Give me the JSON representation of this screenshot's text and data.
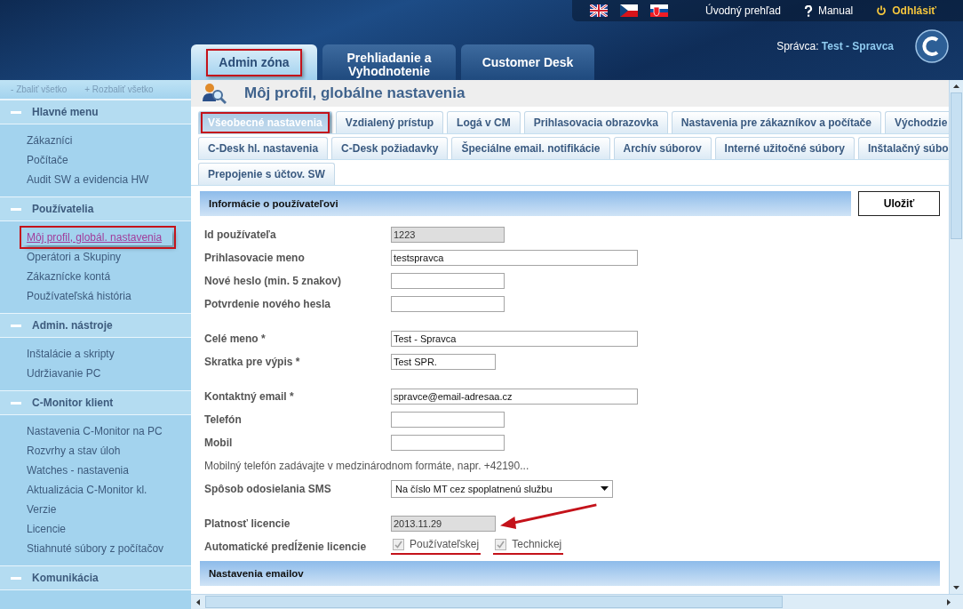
{
  "header": {
    "languages": [
      {
        "kind": "gb"
      },
      {
        "kind": "cz"
      },
      {
        "kind": "sk"
      }
    ],
    "links": [
      {
        "kind": "plain",
        "label": "Úvodný prehľad"
      },
      {
        "kind": "help",
        "label": "Manual"
      },
      {
        "kind": "logout",
        "label": "Odhlásiť"
      }
    ],
    "tabs": [
      {
        "label": "Admin zóna",
        "selected": true,
        "highlighted": true
      },
      {
        "label": "Prehliadanie a Vyhodnotenie",
        "selected": false,
        "highlighted": false
      },
      {
        "label": "Customer Desk",
        "selected": false,
        "highlighted": false
      }
    ],
    "user_label": "Správca:",
    "user_name": "Test - Spravca"
  },
  "sidebar": {
    "collapse_all": "Zbaliť všetko",
    "expand_all": "Rozbaliť všetko",
    "collapse_sign": "-",
    "expand_sign": "+",
    "sections": [
      {
        "title": "Hlavné menu",
        "expanded": true,
        "items": [
          {
            "label": "Zákazníci",
            "selected": false,
            "highlighted": false
          },
          {
            "label": "Počítače",
            "selected": false,
            "highlighted": false
          },
          {
            "label": "Audit SW a evidencia HW",
            "selected": false,
            "highlighted": false
          }
        ]
      },
      {
        "title": "Používatelia",
        "expanded": true,
        "items": [
          {
            "label": "Môj profil, globál. nastavenia",
            "selected": true,
            "highlighted": true
          },
          {
            "label": "Operátori a Skupiny",
            "selected": false,
            "highlighted": false
          },
          {
            "label": "Zákaznícke kontá",
            "selected": false,
            "highlighted": false
          },
          {
            "label": "Používateľská história",
            "selected": false,
            "highlighted": false
          }
        ]
      },
      {
        "title": "Admin. nástroje",
        "expanded": true,
        "items": [
          {
            "label": "Inštalácie a skripty",
            "selected": false,
            "highlighted": false
          },
          {
            "label": "Udržiavanie PC",
            "selected": false,
            "highlighted": false
          }
        ]
      },
      {
        "title": "C-Monitor klient",
        "expanded": true,
        "items": [
          {
            "label": "Nastavenia C-Monitor na PC",
            "selected": false,
            "highlighted": false
          },
          {
            "label": "Rozvrhy a stav úloh",
            "selected": false,
            "highlighted": false
          },
          {
            "label": "Watches - nastavenia",
            "selected": false,
            "highlighted": false
          },
          {
            "label": "Aktualizácia C-Monitor kl.",
            "selected": false,
            "highlighted": false
          },
          {
            "label": "Verzie",
            "selected": false,
            "highlighted": false
          },
          {
            "label": "Licencie",
            "selected": false,
            "highlighted": false
          },
          {
            "label": "Stiahnuté súbory z počítačov",
            "selected": false,
            "highlighted": false
          }
        ]
      },
      {
        "title": "Komunikácia",
        "expanded": true
      }
    ]
  },
  "page": {
    "title": "Môj profil, globálne nastavenia",
    "tab_rows": [
      [
        {
          "label": "Všeobecné nastavenia",
          "selected": true,
          "highlighted": true
        },
        {
          "label": "Vzdialený prístup",
          "selected": false,
          "highlighted": false
        },
        {
          "label": "Logá v CM",
          "selected": false,
          "highlighted": false
        },
        {
          "label": "Prihlasovacia obrazovka",
          "selected": false,
          "highlighted": false
        },
        {
          "label": "Nastavenia pre zákazníkov a počítače",
          "selected": false,
          "highlighted": false
        },
        {
          "label": "Východzie",
          "selected": false,
          "highlighted": false
        }
      ],
      [
        {
          "label": "C-Desk hl. nastavenia",
          "selected": false,
          "highlighted": false
        },
        {
          "label": "C-Desk požiadavky",
          "selected": false,
          "highlighted": false
        },
        {
          "label": "Špeciálne email. notifikácie",
          "selected": false,
          "highlighted": false
        },
        {
          "label": "Archív súborov",
          "selected": false,
          "highlighted": false
        },
        {
          "label": "Interné užitočné súbory",
          "selected": false,
          "highlighted": false
        },
        {
          "label": "Inštalačný súbo",
          "selected": false,
          "highlighted": false
        }
      ],
      [
        {
          "label": "Prepojenie s účtov. SW",
          "selected": false,
          "highlighted": false
        }
      ]
    ],
    "section_title": "Informácie o používateľovi",
    "save_button": "Uložiť",
    "groups": [
      [
        {
          "kind": "medium",
          "label": "Id používateľa",
          "value": "1223",
          "disabled": true
        },
        {
          "kind": "wide",
          "label": "Prihlasovacie meno",
          "value": "testspravca",
          "disabled": false
        },
        {
          "kind": "medium",
          "label": "Nové heslo (min. 5 znakov)",
          "disabled": false
        },
        {
          "kind": "medium",
          "label": "Potvrdenie nového hesla",
          "disabled": false
        }
      ],
      [
        {
          "kind": "wide",
          "label": "Celé meno *",
          "value": "Test - Spravca",
          "disabled": false
        },
        {
          "kind": "short",
          "label": "Skratka pre výpis *",
          "value": "Test SPR.",
          "disabled": false
        }
      ],
      [
        {
          "kind": "wide",
          "label": "Kontaktný email *",
          "value": "spravce@email-adresaa.cz",
          "disabled": false
        },
        {
          "kind": "medium",
          "label": "Telefón",
          "disabled": false
        },
        {
          "kind": "medium",
          "label": "Mobil",
          "disabled": false
        },
        {
          "kind": "note",
          "label": "Mobilný telefón zadávajte v medzinárodnom formáte, napr. +42190..."
        },
        {
          "kind": "select",
          "label": "Spôsob odosielania SMS",
          "value": "Na číslo MT cez spoplatnenú službu"
        }
      ],
      [
        {
          "kind": "short",
          "label": "Platnosť licencie",
          "value": "2013.11.29",
          "disabled": true
        },
        {
          "kind": "checkboxes",
          "label": "Automatické predĺženie licencie",
          "options": [
            {
              "label": "Používateľskej",
              "checked": true,
              "disabled": true,
              "highlighted": true
            },
            {
              "label": "Technickej",
              "checked": true,
              "disabled": true,
              "highlighted": true
            }
          ]
        }
      ]
    ],
    "next_section_title": "Nastavenia emailov"
  }
}
